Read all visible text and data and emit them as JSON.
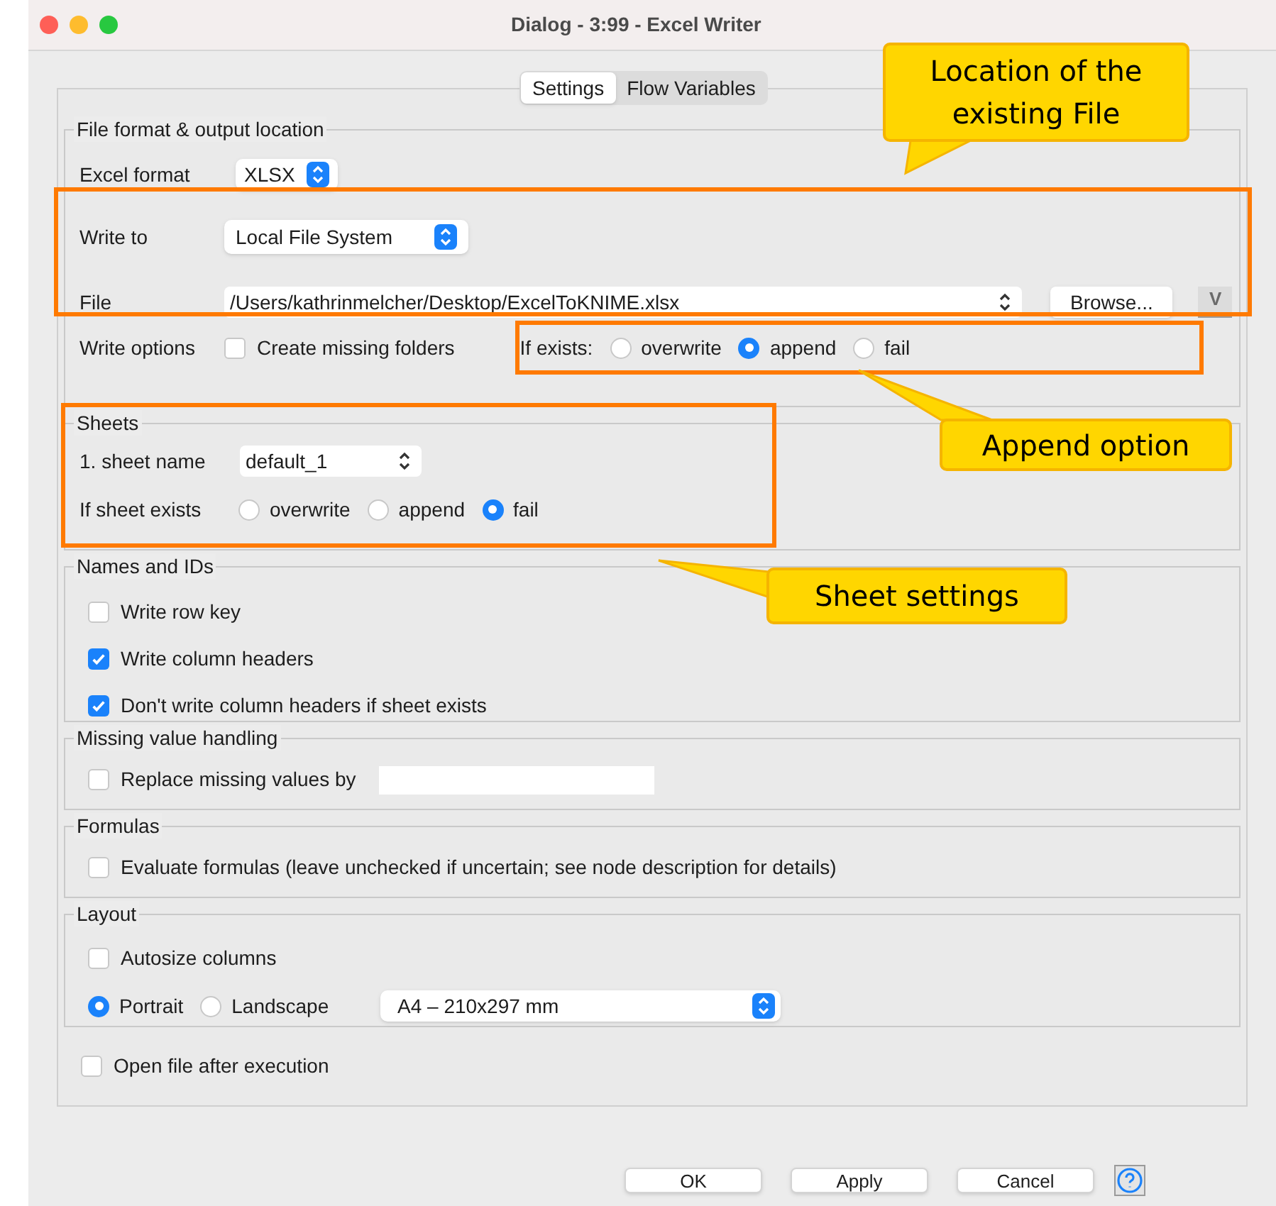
{
  "window": {
    "title": "Dialog - 3:99 - Excel Writer"
  },
  "tabs": [
    {
      "label": "Settings",
      "selected": true
    },
    {
      "label": "Flow Variables",
      "selected": false
    }
  ],
  "file_section": {
    "title": "File format & output location",
    "excel_format": {
      "label": "Excel format",
      "value": "XLSX"
    },
    "write_to": {
      "label": "Write to",
      "value": "Local File System"
    },
    "file": {
      "label": "File",
      "value": "/Users/kathrinmelcher/Desktop/ExcelToKNIME.xlsx",
      "browse": "Browse...",
      "variable_button": "V"
    },
    "write_options": {
      "label": "Write options",
      "create_missing_folders": {
        "label": "Create missing folders",
        "checked": false
      }
    },
    "if_exists": {
      "label": "If exists:",
      "options": [
        {
          "label": "overwrite",
          "selected": false
        },
        {
          "label": "append",
          "selected": true
        },
        {
          "label": "fail",
          "selected": false
        }
      ]
    }
  },
  "sheets": {
    "title": "Sheets",
    "sheet_name": {
      "label": "1. sheet name",
      "value": "default_1"
    },
    "if_sheet_exists": {
      "label": "If sheet exists",
      "options": [
        {
          "label": "overwrite",
          "selected": false
        },
        {
          "label": "append",
          "selected": false
        },
        {
          "label": "fail",
          "selected": true
        }
      ]
    }
  },
  "names_and_ids": {
    "title": "Names and IDs",
    "options": [
      {
        "label": "Write row key",
        "checked": false
      },
      {
        "label": "Write column headers",
        "checked": true
      },
      {
        "label": "Don't write column headers if sheet exists",
        "checked": true
      }
    ]
  },
  "missing_values": {
    "title": "Missing value handling",
    "replace": {
      "label": "Replace missing values by",
      "checked": false
    }
  },
  "formulas": {
    "title": "Formulas",
    "evaluate": {
      "label": "Evaluate formulas (leave unchecked if uncertain; see node description for details)",
      "checked": false
    }
  },
  "layout": {
    "title": "Layout",
    "autosize": {
      "label": "Autosize columns",
      "checked": false
    },
    "orientation": [
      {
        "label": "Portrait",
        "selected": true
      },
      {
        "label": "Landscape",
        "selected": false
      }
    ],
    "paper_size": "A4 – 210x297 mm"
  },
  "open_file": {
    "label": "Open file after execution",
    "checked": false
  },
  "buttons": [
    {
      "label": "OK"
    },
    {
      "label": "Apply"
    },
    {
      "label": "Cancel"
    }
  ],
  "annotations": [
    {
      "kind": "callout",
      "text": "Location of the\nexisting File"
    },
    {
      "kind": "highlight"
    },
    {
      "kind": "highlight"
    },
    {
      "kind": "callout",
      "text": "Append option"
    },
    {
      "kind": "highlight"
    },
    {
      "kind": "callout",
      "text": "Sheet settings"
    }
  ]
}
